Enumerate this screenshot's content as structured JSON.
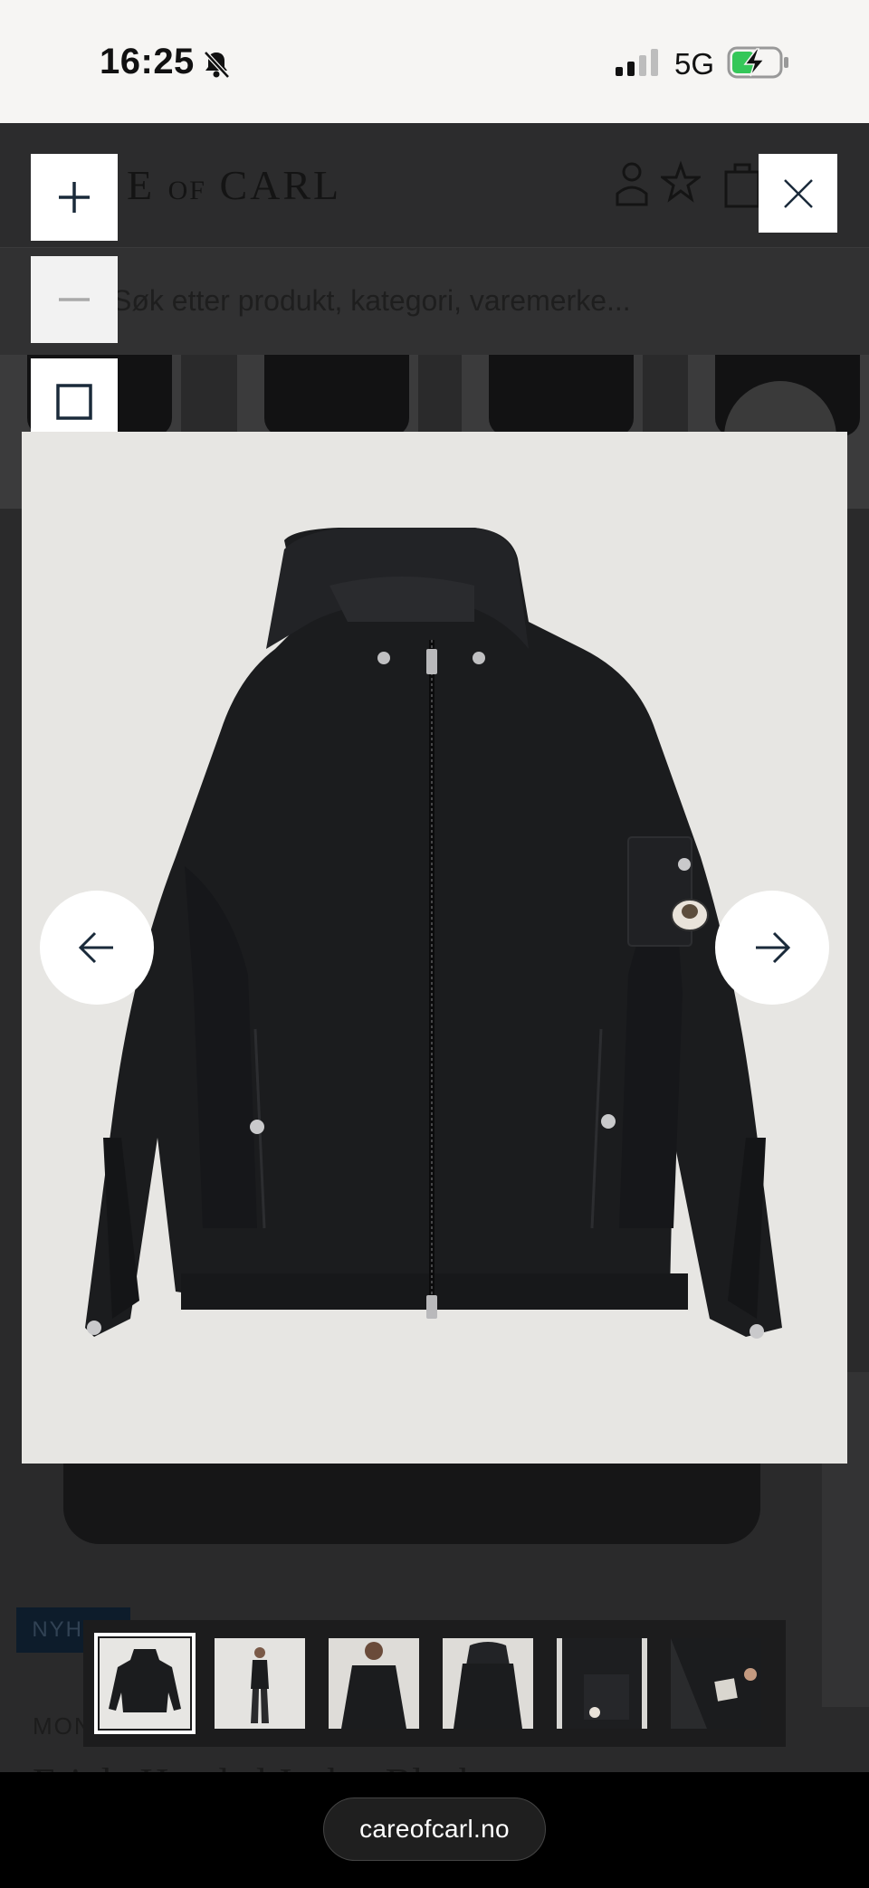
{
  "status_bar": {
    "time": "16:25",
    "network": "5G",
    "icons": [
      "bell-slash-icon",
      "signal-icon",
      "battery-charging-icon"
    ]
  },
  "underlying_page": {
    "logo_left": "E",
    "logo_small": "OF",
    "logo_right": "CARL",
    "search_placeholder": "Søk etter produkt, kategori, varemerke...",
    "badge": "NYHET",
    "brand": "MONCLER",
    "product_title": "Erinle Hooded Jacket Black"
  },
  "lightbox": {
    "zoom_in_icon": "plus-icon",
    "zoom_out_icon": "minus-icon",
    "fullscreen_icon": "square-icon",
    "close_icon": "close-icon",
    "prev_icon": "arrow-left-icon",
    "next_icon": "arrow-right-icon",
    "thumbnail_count": 6,
    "active_thumbnail": 1
  },
  "browser": {
    "url": "careofcarl.no"
  },
  "colors": {
    "status_bar_bg": "#f6f5f3",
    "overlay_bg": "#2b2b2c",
    "image_bg": "#e7e6e3",
    "jacket": "#1b1c1e",
    "badge_bg": "#0d1c2b"
  }
}
